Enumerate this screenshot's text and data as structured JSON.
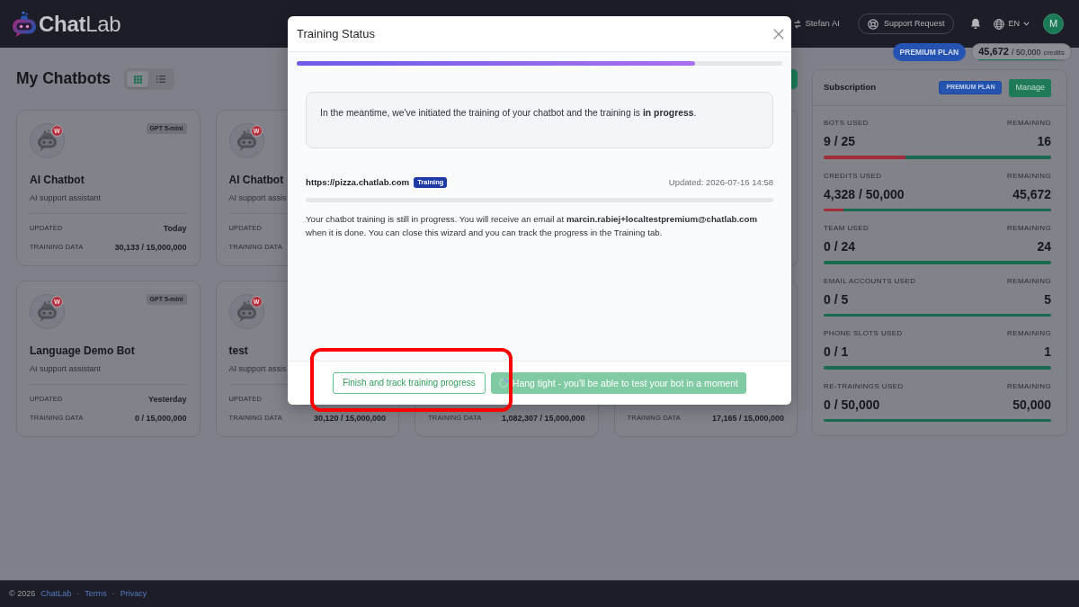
{
  "navbar": {
    "brand": "**Chat**Lab",
    "workspace": "Stefan AI",
    "support_button": "Support Request",
    "language": "EN",
    "avatar_initial": "M"
  },
  "plan_strip": {
    "plan": "PREMIUM PLAN",
    "credits_left": "45,672",
    "credits_total": "/ 50,000",
    "credits_unit": "credits",
    "level": 0.91
  },
  "page_title": "My Chatbots",
  "view_toggle": [
    {
      "kind": "grid",
      "selected": true
    },
    {
      "kind": "list",
      "selected": false
    }
  ],
  "chatbot_rows": [
    [
      {
        "badge": "W",
        "model": "GPT 5-mini",
        "name": "AI Chatbot",
        "description": "AI support assistant",
        "updated_label": "UPDATED",
        "updated": "Today",
        "training_label": "TRAINING DATA",
        "training": "30,133 / 15,000,000"
      },
      {
        "badge": "W",
        "name": "AI Chatbot",
        "description": "AI support assis",
        "updated_label": "UPDATED",
        "training_label": "TRAINING DATA"
      }
    ],
    [
      {
        "badge": "W",
        "model": "GPT 5-mini",
        "name": "Language Demo Bot",
        "description": "AI support assistant",
        "updated_label": "UPDATED",
        "updated": "Yesterday",
        "training_label": "TRAINING DATA",
        "training": "0 / 15,000,000"
      },
      {
        "badge": "W",
        "name": "test",
        "description": "AI support assis",
        "updated_label": "UPDATED",
        "training_label": "TRAINING DATA",
        "training": "30,120 / 15,000,000"
      },
      {
        "training_label": "TRAINING DATA",
        "training": "1,082,307 / 15,000,000"
      },
      {
        "training_label": "TRAINING DATA",
        "training": "17,165 / 15,000,000"
      }
    ]
  ],
  "subscription": {
    "title": "Subscription",
    "plan": "PREMIUM PLAN",
    "manage": "Manage",
    "quotas": [
      {
        "label": "BOTS USED",
        "remaining_label": "REMAINING",
        "value": "9 / 25",
        "remaining": "16",
        "level": 0.64
      },
      {
        "label": "CREDITS USED",
        "remaining_label": "REMAINING",
        "value": "4,328 / 50,000",
        "remaining": "45,672",
        "level": 0.913
      },
      {
        "label": "TEAM USED",
        "remaining_label": "REMAINING",
        "value": "0 / 24",
        "remaining": "24",
        "level": 1
      },
      {
        "label": "EMAIL ACCOUNTS USED",
        "remaining_label": "REMAINING",
        "value": "0 / 5",
        "remaining": "5",
        "level": 1
      },
      {
        "label": "PHONE SLOTS USED",
        "remaining_label": "REMAINING",
        "value": "0 / 1",
        "remaining": "1",
        "level": 1
      },
      {
        "label": "RE-TRAININGS USED",
        "remaining_label": "REMAINING",
        "value": "0 / 50,000",
        "remaining": "50,000",
        "level": 1
      }
    ]
  },
  "modal": {
    "title": "Training Status",
    "progress": {
      "level": 0.82
    },
    "notice": "In the meantime, we've initiated the training of your chatbot and the training is **in progress**.",
    "source": {
      "url": "https://pizza.chatlab.com",
      "status": "Training",
      "updated": "Updated: 2026-07-16 14:58"
    },
    "message": "Your chatbot training is still in progress. You will receive an email at **marcin.rabiej+localtestpremium@chatlab.com** when it is done. You can close this wizard and you can track the progress in the Training tab.",
    "buttons": [
      {
        "kind": "outline",
        "label": "Finish and track training progress",
        "disabled": false,
        "highlighted": true
      },
      {
        "kind": "loading",
        "label": "Hang tight - you'll be able to test your bot in a moment",
        "disabled": true,
        "highlighted": false
      }
    ]
  },
  "footer": {
    "items": [
      {
        "kind": "text",
        "text": "© 2026"
      },
      {
        "kind": "link",
        "text": "ChatLab"
      },
      {
        "kind": "separator",
        "text": "·"
      },
      {
        "kind": "link",
        "text": "Terms"
      },
      {
        "kind": "separator",
        "text": "·"
      },
      {
        "kind": "link",
        "text": "Privacy"
      }
    ]
  }
}
